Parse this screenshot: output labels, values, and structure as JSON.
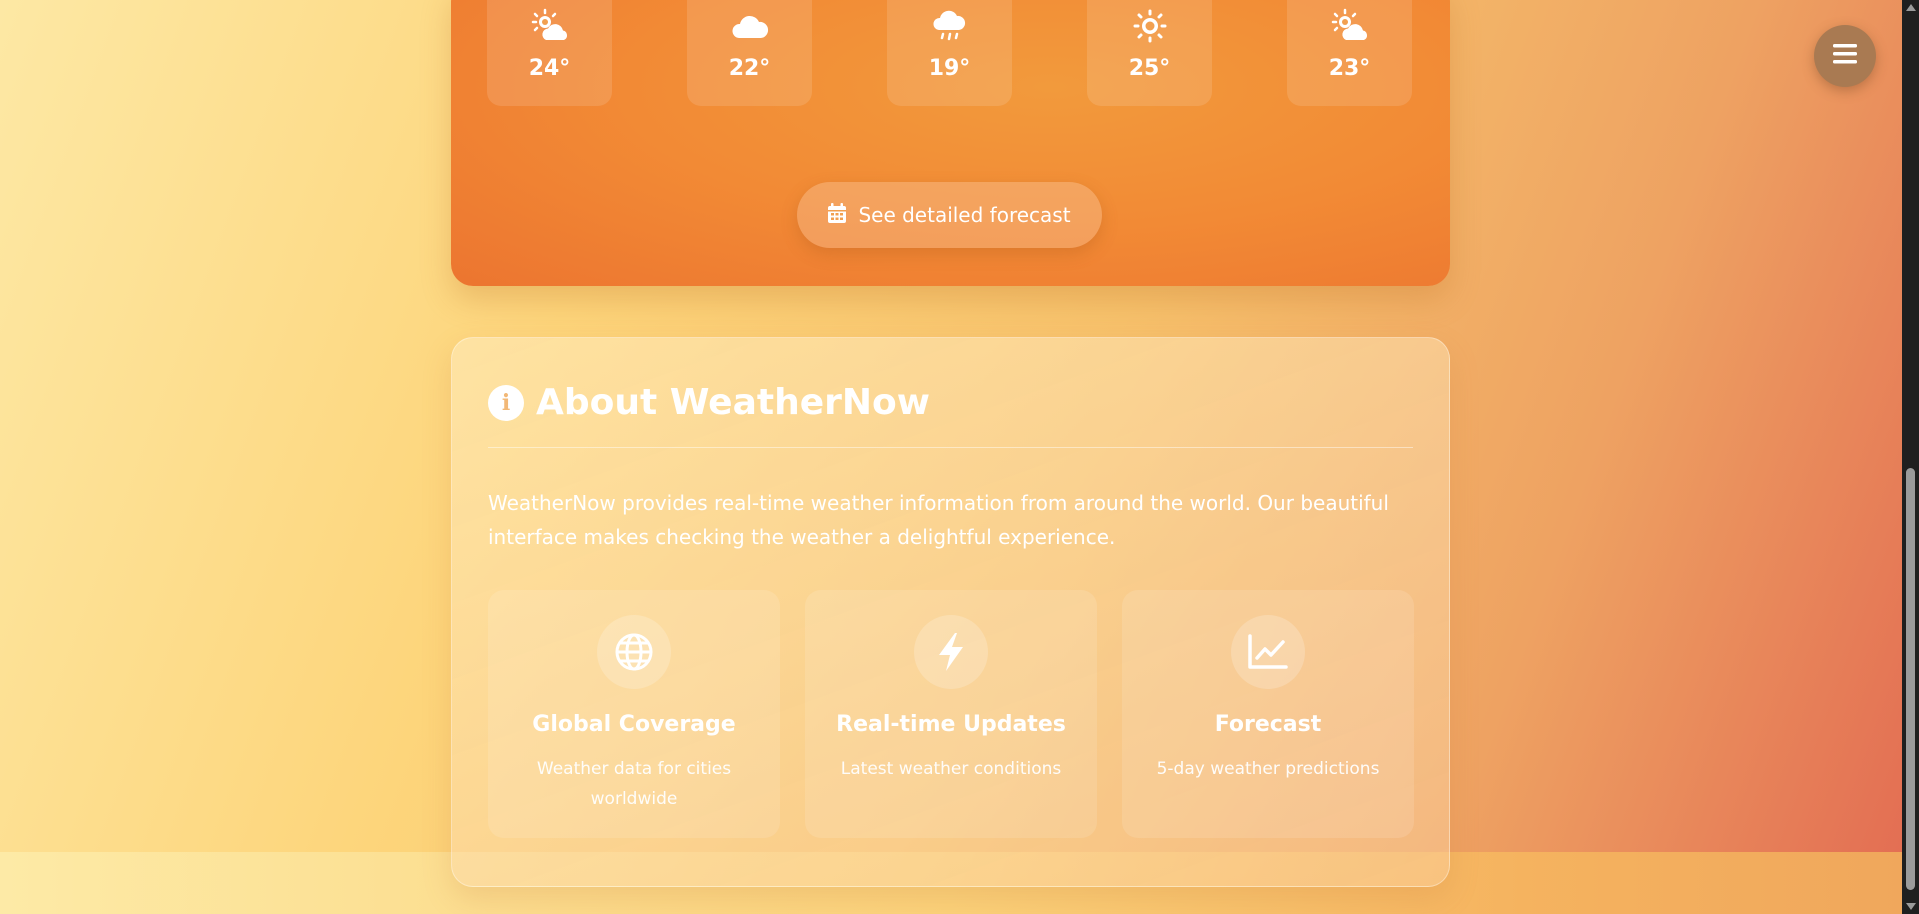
{
  "forecast": {
    "days": [
      {
        "icon": "sun-cloud-icon",
        "temp": "24°"
      },
      {
        "icon": "cloud-icon",
        "temp": "22°"
      },
      {
        "icon": "rain-cloud-icon",
        "temp": "19°"
      },
      {
        "icon": "sun-icon",
        "temp": "25°"
      },
      {
        "icon": "sun-cloud-icon",
        "temp": "23°"
      }
    ],
    "detailed_button": {
      "icon": "calendar-icon",
      "label": "See detailed forecast"
    }
  },
  "about": {
    "icon": "info-icon",
    "title": "About WeatherNow",
    "description": "WeatherNow provides real-time weather information from around the world. Our beautiful interface makes checking the weather a delightful experience.",
    "features": [
      {
        "icon": "globe-icon",
        "title": "Global Coverage",
        "description": "Weather data for cities worldwide"
      },
      {
        "icon": "lightning-icon",
        "title": "Real-time Updates",
        "description": "Latest weather conditions"
      },
      {
        "icon": "chart-line-icon",
        "title": "Forecast",
        "description": "5-day weather predictions"
      }
    ]
  },
  "menu_button": {
    "icon": "hamburger-menu-icon"
  },
  "colors": {
    "forecast_card": "#f28a35",
    "menu_button": "#a97a52",
    "scrollbar_track": "#1f1f1f"
  }
}
